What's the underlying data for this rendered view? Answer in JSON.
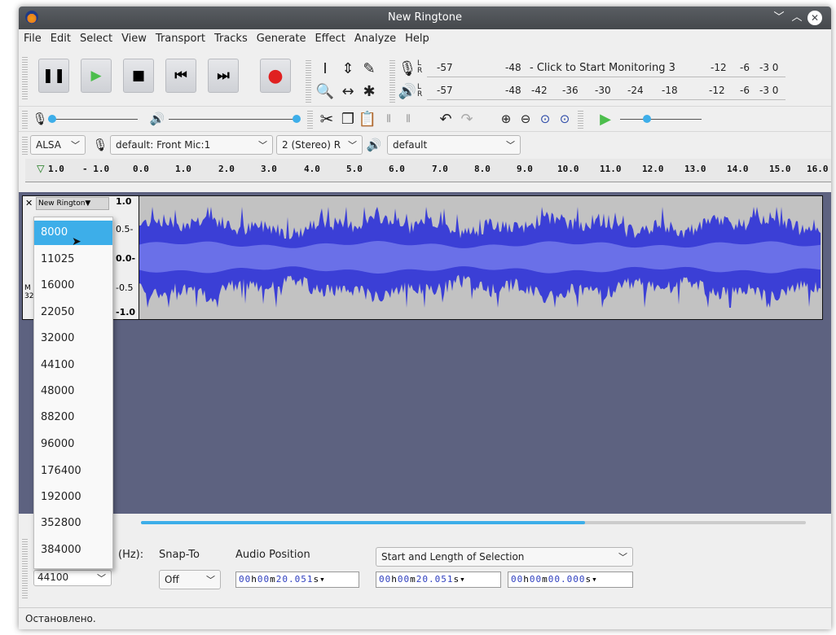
{
  "window": {
    "title": "New Ringtone"
  },
  "menu": [
    "File",
    "Edit",
    "Select",
    "View",
    "Transport",
    "Tracks",
    "Generate",
    "Effect",
    "Analyze",
    "Help"
  ],
  "meters": {
    "record_scale": [
      "-57",
      "-48",
      "- Click to Start Monitoring 3",
      "-12",
      "-6",
      "-3 0"
    ],
    "play_scale": [
      "-57",
      "-48",
      "-42",
      "-36",
      "-30",
      "-24",
      "-18",
      "-12",
      "-6",
      "-3 0"
    ],
    "lr_top": "L\nR",
    "lr_bottom": "L\nR"
  },
  "device": {
    "host": "ALSA",
    "recording_device": "default: Front Mic:1",
    "channels": "2 (Stereo) R",
    "playback_device": "default"
  },
  "ruler": {
    "labels": [
      "1.0",
      "- 1.0",
      "0.0",
      "1.0",
      "2.0",
      "3.0",
      "4.0",
      "5.0",
      "6.0",
      "7.0",
      "8.0",
      "9.0",
      "10.0",
      "11.0",
      "12.0",
      "13.0",
      "14.0",
      "15.0",
      "16.0"
    ]
  },
  "track": {
    "name": "New Rington▼",
    "scale": [
      "1.0",
      "0.5-",
      "0.0-",
      "-0.5",
      "-1.0"
    ],
    "partial_info": [
      "M",
      "32"
    ]
  },
  "rate_dropdown": {
    "options": [
      "8000",
      "11025",
      "16000",
      "22050",
      "32000",
      "44100",
      "48000",
      "88200",
      "96000",
      "176400",
      "192000",
      "352800",
      "384000"
    ],
    "highlighted": "8000"
  },
  "bottom": {
    "rate_label": "(Hz):",
    "rate_value": "44100",
    "snap_label": "Snap-To",
    "snap_value": "Off",
    "audio_position_label": "Audio Position",
    "selection_mode": "Start and Length of Selection",
    "audio_position": [
      "00",
      "h",
      "00",
      "m",
      "20.051",
      "s"
    ],
    "selection_start": [
      "00",
      "h",
      "00",
      "m",
      "20.051",
      "s"
    ],
    "selection_length": [
      "00",
      "h",
      "00",
      "m",
      "00.000",
      "s"
    ]
  },
  "status": {
    "text": "Остановлено."
  },
  "colors": {
    "waveform": "#3b3fd6",
    "waveform_rms": "#6a70e8",
    "track_bg": "#5d6280",
    "highlight": "#3daee9"
  }
}
